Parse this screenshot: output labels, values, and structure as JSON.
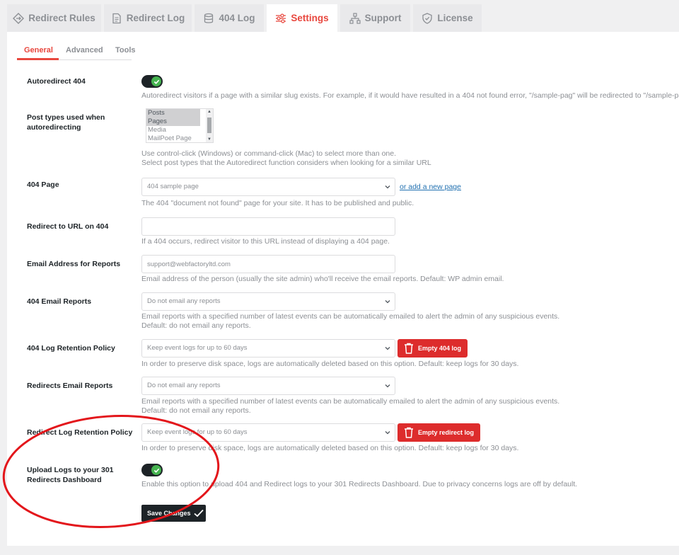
{
  "tabs": [
    {
      "label": "Redirect Rules",
      "icon": "diamond-arrows-icon"
    },
    {
      "label": "Redirect Log",
      "icon": "document-icon"
    },
    {
      "label": "404 Log",
      "icon": "database-icon"
    },
    {
      "label": "Settings",
      "icon": "sliders-icon"
    },
    {
      "label": "Support",
      "icon": "sitemap-icon"
    },
    {
      "label": "License",
      "icon": "shield-check-icon"
    }
  ],
  "subtabs": [
    "General",
    "Advanced",
    "Tools"
  ],
  "settings": {
    "autoredirect": {
      "label": "Autoredirect 404",
      "help": "Autoredirect visitors if a page with a similar slug exists. For example, if it would have resulted in a 404 not found error, \"/sample-pag\" will be redirected to \"/sample-page\"",
      "enabled": true
    },
    "post_types": {
      "label": "Post types used when autoredirecting",
      "options": [
        "Posts",
        "Pages",
        "Media",
        "MailPoet Page"
      ],
      "selected": [
        "Posts",
        "Pages"
      ],
      "help1": "Use control-click (Windows) or command-click (Mac) to select more than one.",
      "help2": "Select post types that the Autoredirect function considers when looking for a similar URL"
    },
    "page_404": {
      "label": "404 Page",
      "value": "404 sample page",
      "link": "or add a new page",
      "help": "The 404 \"document not found\" page for your site. It has to be published and public."
    },
    "redirect_url": {
      "label": "Redirect to URL on 404",
      "value": "",
      "help": "If a 404 occurs, redirect visitor to this URL instead of displaying a 404 page."
    },
    "email_address": {
      "label": "Email Address for Reports",
      "placeholder": "support@webfactoryltd.com",
      "help": "Email address of the person (usually the site admin) who'll receive the email reports. Default: WP admin email."
    },
    "email_404": {
      "label": "404 Email Reports",
      "value": "Do not email any reports",
      "help1": "Email reports with a specified number of latest events can be automatically emailed to alert the admin of any suspicious events.",
      "help2": "Default: do not email any reports."
    },
    "retention_404": {
      "label": "404 Log Retention Policy",
      "value": "Keep event logs for up to 60 days",
      "button": "Empty 404 log",
      "help": "In order to preserve disk space, logs are automatically deleted based on this option. Default: keep logs for 30 days."
    },
    "email_redirects": {
      "label": "Redirects Email Reports",
      "value": "Do not email any reports",
      "help1": "Email reports with a specified number of latest events can be automatically emailed to alert the admin of any suspicious events.",
      "help2": "Default: do not email any reports."
    },
    "retention_redirect": {
      "label": "Redirect Log Retention Policy",
      "value": "Keep event logs for up to 60 days",
      "button": "Empty redirect log",
      "help": "In order to preserve disk space, logs are automatically deleted based on this option. Default: keep logs for 30 days."
    },
    "upload_logs": {
      "label": "Upload Logs to your 301 Redirects Dashboard",
      "help": "Enable this option to upload 404 and Redirect logs to your 301 Redirects Dashboard. Due to privacy concerns logs are off by default.",
      "enabled": true
    },
    "save_label": "Save Changes"
  },
  "colors": {
    "accent": "#e8473e",
    "danger": "#dd2c2c",
    "toggle_on": "#46b450",
    "annotation": "#e3161b"
  }
}
